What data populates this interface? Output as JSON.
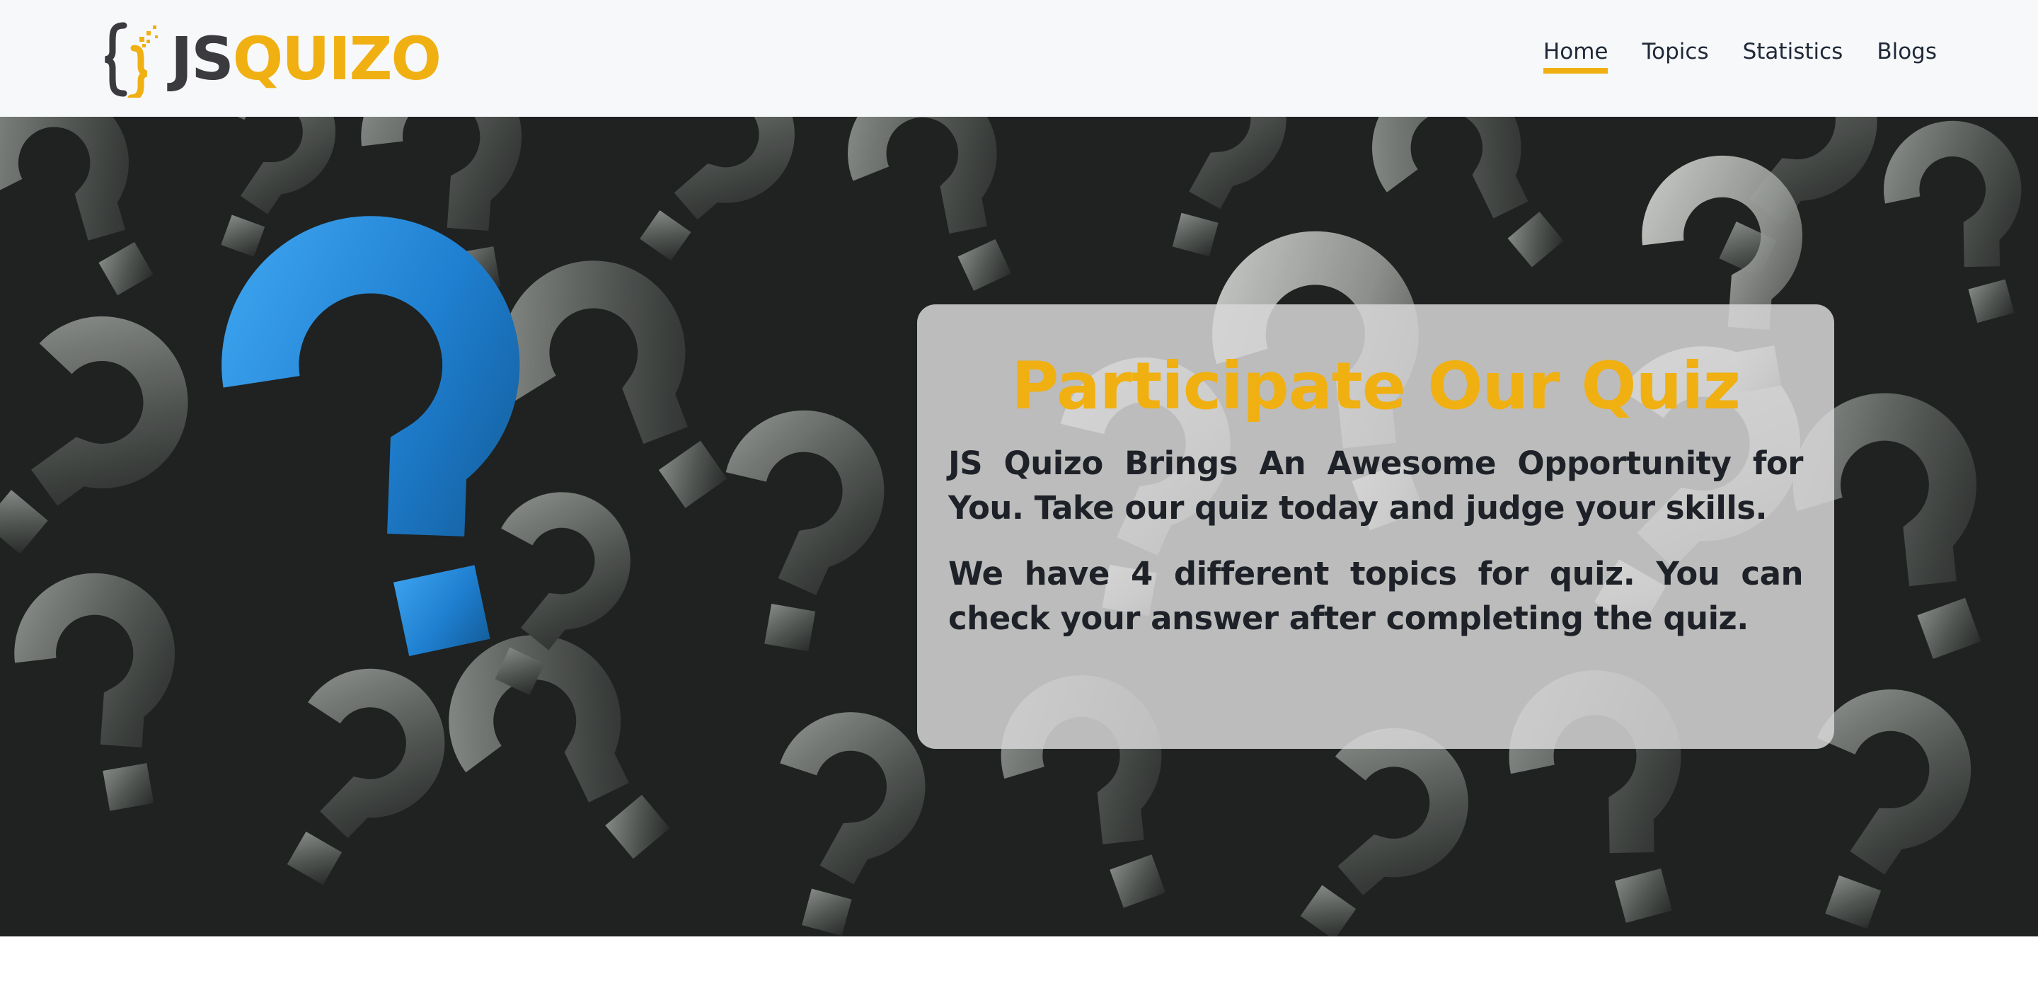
{
  "brand": {
    "prefix": "JS",
    "suffix": "QUIZO",
    "dark_color": "#3a3a3f",
    "accent_color": "#f0b012"
  },
  "nav": {
    "items": [
      {
        "label": "Home",
        "active": true
      },
      {
        "label": "Topics",
        "active": false
      },
      {
        "label": "Statistics",
        "active": false
      },
      {
        "label": "Blogs",
        "active": false
      }
    ]
  },
  "hero": {
    "background": "dark field of 3D question marks with one blue question mark",
    "title": "Participate Our Quiz",
    "paragraph_1": "JS Quizo Brings An Awesome Opportunity for You. Take our quiz today and judge your skills.",
    "paragraph_2": "We have 4 different topics for quiz. You can check your answer after completing the quiz.",
    "highlight_color": "#2d8fe0"
  },
  "icons": {
    "logo": "curly-braces-logo-icon",
    "hero_image": "question-marks-image"
  }
}
